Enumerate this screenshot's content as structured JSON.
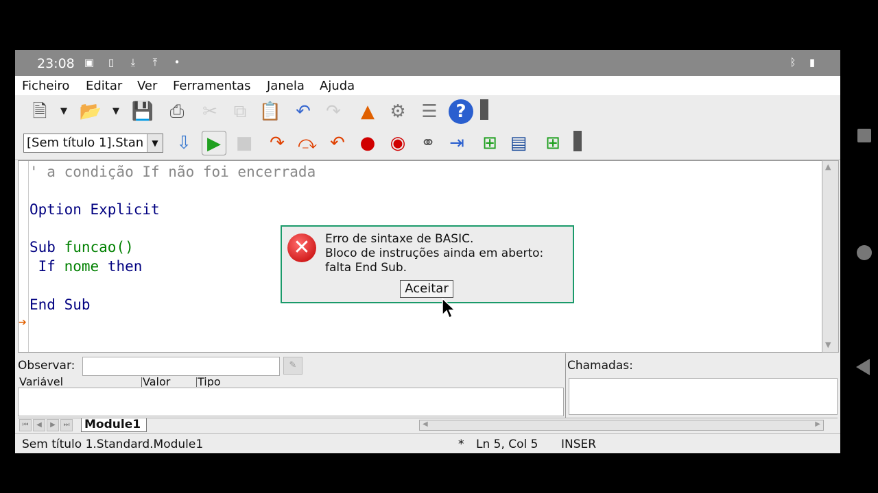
{
  "android_status": {
    "time": "23:08"
  },
  "menu": {
    "items": [
      "Ficheiro",
      "Editar",
      "Ver",
      "Ferramentas",
      "Janela",
      "Ajuda"
    ]
  },
  "toolbar": {
    "library_select": "[Sem título 1].Stan"
  },
  "editor": {
    "lines": [
      {
        "text": "' a condição If não foi encerrada"
      },
      {
        "kw1": "Option Explicit"
      },
      {
        "kw": "Sub",
        "id": "funcao()"
      },
      {
        "kw": "If",
        "id": "nome",
        "kw2": "then"
      },
      {
        "kw1": "End Sub"
      }
    ]
  },
  "dialog": {
    "line1": "Erro de sintaxe de BASIC.",
    "line2": "Bloco de instruções ainda em aberto:",
    "line3": "falta End Sub.",
    "ok_label": "Aceitar"
  },
  "watch": {
    "label": "Observar:",
    "columns": [
      "Variável",
      "Valor",
      "Tipo"
    ]
  },
  "calls": {
    "label": "Chamadas:"
  },
  "tabs": [
    {
      "label": "Module1"
    }
  ],
  "status": {
    "location": "Sem título 1.Standard.Module1",
    "modified": "*",
    "position": "Ln 5, Col 5",
    "mode": "INSER"
  }
}
